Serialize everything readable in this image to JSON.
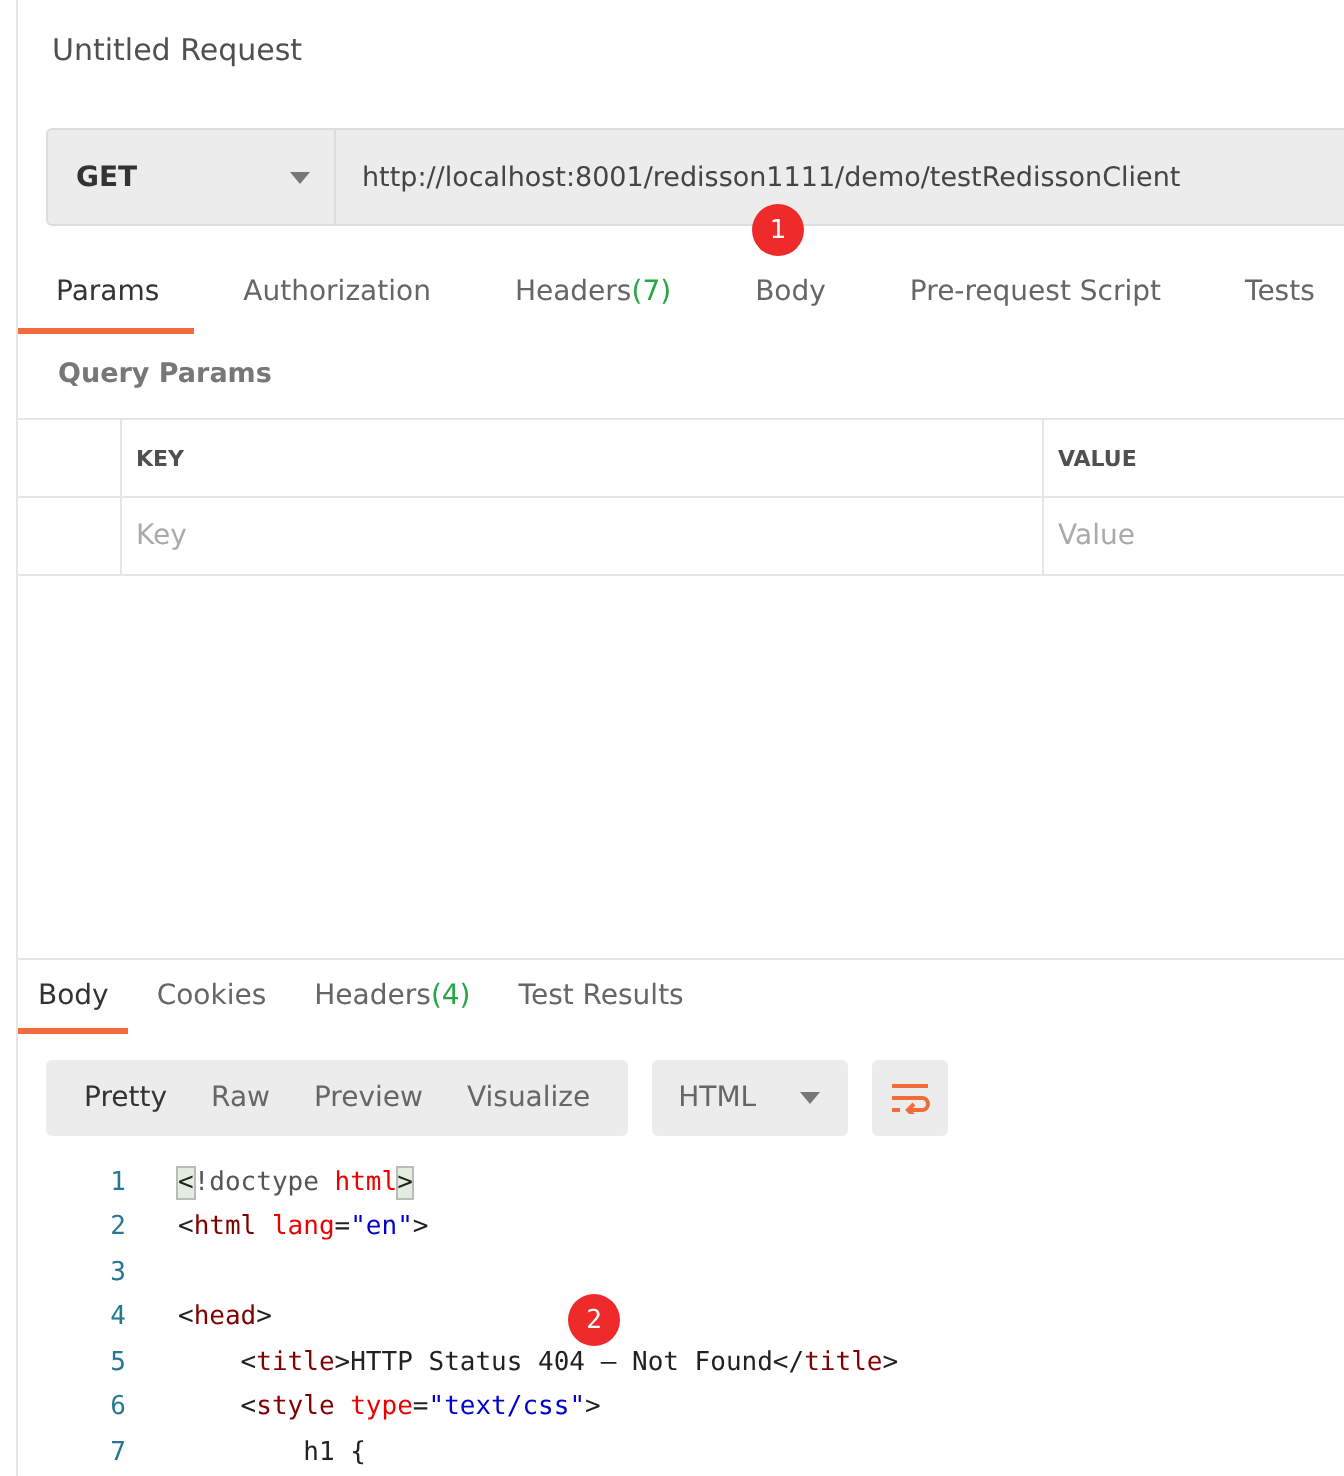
{
  "request": {
    "title": "Untitled Request",
    "method": "GET",
    "url": "http://localhost:8001/redisson1111/demo/testRedissonClient"
  },
  "request_tabs": [
    {
      "label": "Params",
      "selected": true
    },
    {
      "label": "Authorization",
      "selected": false
    },
    {
      "label": "Headers",
      "count": "(7)",
      "selected": false
    },
    {
      "label": "Body",
      "selected": false
    },
    {
      "label": "Pre-request Script",
      "selected": false
    },
    {
      "label": "Tests",
      "selected": false
    }
  ],
  "query_params": {
    "title": "Query Params",
    "columns": [
      "KEY",
      "VALUE"
    ],
    "placeholders": [
      "Key",
      "Value"
    ]
  },
  "response_tabs": [
    {
      "label": "Body",
      "selected": true
    },
    {
      "label": "Cookies",
      "selected": false
    },
    {
      "label": "Headers",
      "count": "(4)",
      "selected": false
    },
    {
      "label": "Test Results",
      "selected": false
    }
  ],
  "view_modes": [
    {
      "label": "Pretty",
      "selected": true
    },
    {
      "label": "Raw",
      "selected": false
    },
    {
      "label": "Preview",
      "selected": false
    },
    {
      "label": "Visualize",
      "selected": false
    }
  ],
  "format": "HTML",
  "code_lines": [
    {
      "number": "1",
      "tokens": [
        {
          "text": "<",
          "kind": "match"
        },
        {
          "text": "!doctype ",
          "kind": "meta"
        },
        {
          "text": "html",
          "kind": "attr"
        },
        {
          "text": ">",
          "kind": "match"
        }
      ]
    },
    {
      "number": "2",
      "tokens": [
        {
          "text": "<",
          "kind": "punct"
        },
        {
          "text": "html",
          "kind": "tag"
        },
        {
          "text": " lang",
          "kind": "attr"
        },
        {
          "text": "=",
          "kind": "punct"
        },
        {
          "text": "\"en\"",
          "kind": "string"
        },
        {
          "text": ">",
          "kind": "punct"
        }
      ]
    },
    {
      "number": "3"
    },
    {
      "number": "4",
      "tokens": [
        {
          "text": "<",
          "kind": "punct"
        },
        {
          "text": "head",
          "kind": "tag"
        },
        {
          "text": ">",
          "kind": "punct"
        }
      ]
    },
    {
      "number": "5",
      "tokens": [
        {
          "text": "    <",
          "kind": "punct"
        },
        {
          "text": "title",
          "kind": "tag"
        },
        {
          "text": ">HTTP Status 404 – Not Found</",
          "kind": "punct"
        },
        {
          "text": "title",
          "kind": "tag"
        },
        {
          "text": ">",
          "kind": "punct"
        }
      ]
    },
    {
      "number": "6",
      "tokens": [
        {
          "text": "    <",
          "kind": "punct"
        },
        {
          "text": "style",
          "kind": "tag"
        },
        {
          "text": " type",
          "kind": "attr"
        },
        {
          "text": "=",
          "kind": "punct"
        },
        {
          "text": "\"text/css\"",
          "kind": "string"
        },
        {
          "text": ">",
          "kind": "punct"
        }
      ]
    },
    {
      "number": "7",
      "tokens": [
        {
          "text": "        h1 {",
          "kind": "punct"
        }
      ]
    }
  ],
  "annotations": [
    "1",
    "2"
  ]
}
